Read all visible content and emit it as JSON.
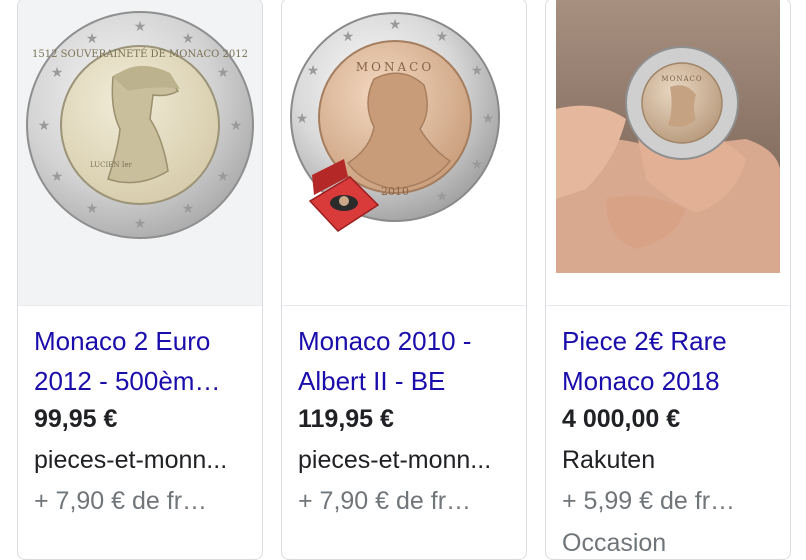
{
  "products": [
    {
      "title": "Monaco 2 Euro 2012 - 500èm…",
      "price": "99,95 €",
      "merchant": "pieces-et-monn...",
      "shipping": "+ 7,90 € de fr…",
      "coin_text": "1512 SOUVERAINETÉ DE MONACO 2012",
      "coin_label": "LUCIEN Ier"
    },
    {
      "title": "Monaco 2010 - Albert II - BE",
      "price": "119,95 €",
      "merchant": "pieces-et-monn...",
      "shipping": "+ 7,90 € de fr…",
      "coin_text": "MONACO",
      "coin_year": "2010"
    },
    {
      "title": "Piece 2€ Rare Monaco 2018",
      "price": "4 000,00 €",
      "merchant": "Rakuten",
      "shipping": "+ 5,99 € de fr…",
      "condition": "Occasion",
      "coin_text": "MONACO"
    }
  ],
  "colors": {
    "link": "#1a0dab",
    "text": "#202124",
    "muted": "#70757a",
    "border": "#dadce0"
  }
}
